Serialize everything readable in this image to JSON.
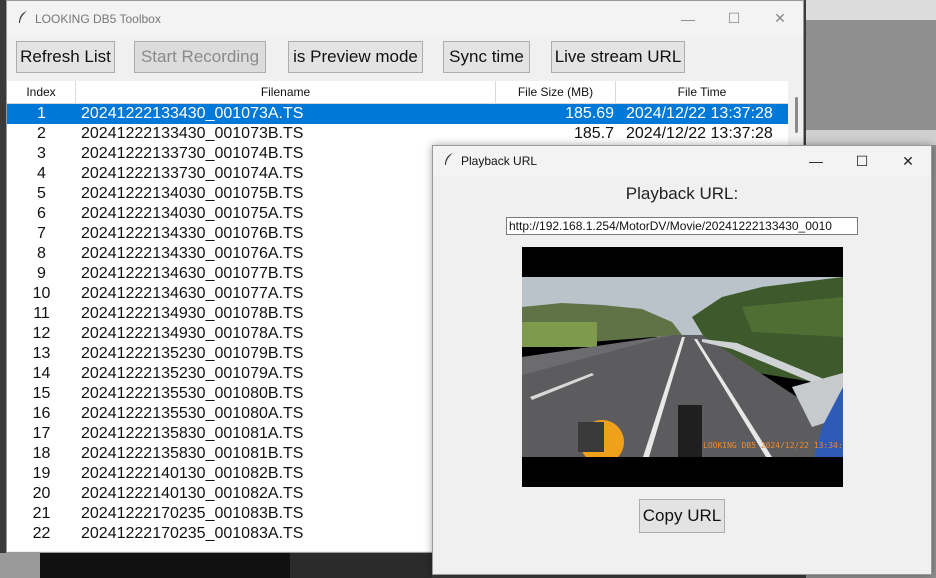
{
  "main_window": {
    "title": "LOOKING DB5 Toolbox",
    "controls": {
      "minimize": "—",
      "maximize": "☐",
      "close": "✕"
    },
    "toolbar": {
      "refresh_label": "Refresh List",
      "start_recording_label": "Start Recording",
      "preview_mode_label": "is Preview mode",
      "sync_time_label": "Sync time",
      "live_stream_label": "Live stream URL"
    },
    "table": {
      "headers": {
        "index": "Index",
        "filename": "Filename",
        "size": "File Size (MB)",
        "time": "File Time"
      },
      "rows": [
        {
          "index": "1",
          "filename": "20241222133430_001073A.TS",
          "size": "185.69",
          "time": "2024/12/22 13:37:28"
        },
        {
          "index": "2",
          "filename": "20241222133430_001073B.TS",
          "size": "185.7",
          "time": "2024/12/22 13:37:28"
        },
        {
          "index": "3",
          "filename": "20241222133730_001074B.TS",
          "size": "",
          "time": ""
        },
        {
          "index": "4",
          "filename": "20241222133730_001074A.TS",
          "size": "",
          "time": ""
        },
        {
          "index": "5",
          "filename": "20241222134030_001075B.TS",
          "size": "",
          "time": ""
        },
        {
          "index": "6",
          "filename": "20241222134030_001075A.TS",
          "size": "",
          "time": ""
        },
        {
          "index": "7",
          "filename": "20241222134330_001076B.TS",
          "size": "",
          "time": ""
        },
        {
          "index": "8",
          "filename": "20241222134330_001076A.TS",
          "size": "",
          "time": ""
        },
        {
          "index": "9",
          "filename": "20241222134630_001077B.TS",
          "size": "",
          "time": ""
        },
        {
          "index": "10",
          "filename": "20241222134630_001077A.TS",
          "size": "",
          "time": ""
        },
        {
          "index": "11",
          "filename": "20241222134930_001078B.TS",
          "size": "",
          "time": ""
        },
        {
          "index": "12",
          "filename": "20241222134930_001078A.TS",
          "size": "",
          "time": ""
        },
        {
          "index": "13",
          "filename": "20241222135230_001079B.TS",
          "size": "",
          "time": ""
        },
        {
          "index": "14",
          "filename": "20241222135230_001079A.TS",
          "size": "",
          "time": ""
        },
        {
          "index": "15",
          "filename": "20241222135530_001080B.TS",
          "size": "",
          "time": ""
        },
        {
          "index": "16",
          "filename": "20241222135530_001080A.TS",
          "size": "",
          "time": ""
        },
        {
          "index": "17",
          "filename": "20241222135830_001081A.TS",
          "size": "",
          "time": ""
        },
        {
          "index": "18",
          "filename": "20241222135830_001081B.TS",
          "size": "",
          "time": ""
        },
        {
          "index": "19",
          "filename": "20241222140130_001082B.TS",
          "size": "",
          "time": ""
        },
        {
          "index": "20",
          "filename": "20241222140130_001082A.TS",
          "size": "",
          "time": ""
        },
        {
          "index": "21",
          "filename": "20241222170235_001083B.TS",
          "size": "",
          "time": ""
        },
        {
          "index": "22",
          "filename": "20241222170235_001083A.TS",
          "size": "",
          "time": ""
        }
      ],
      "selected_row": 0
    }
  },
  "playback_window": {
    "title": "Playback URL",
    "controls": {
      "minimize": "—",
      "maximize": "☐",
      "close": "✕"
    },
    "label": "Playback URL:",
    "url_value": "http://192.168.1.254/MotorDV/Movie/20241222133430_0010",
    "video_overlay_text": "LOOKING DB5 2024/12/22 13:34:28",
    "copy_label": "Copy URL"
  },
  "colors": {
    "selection": "#0078d7",
    "window_bg": "#f0f0f0"
  },
  "icons": {
    "app": "feather-icon"
  }
}
